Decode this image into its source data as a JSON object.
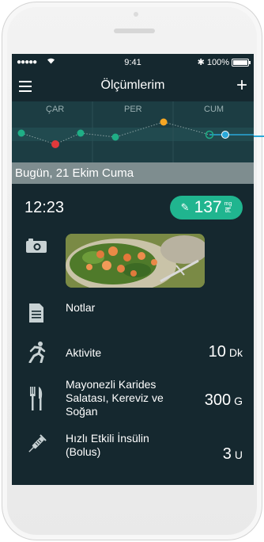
{
  "status_bar": {
    "signal": "●●●●● ",
    "time": "9:41",
    "battery": "✱ 100%"
  },
  "nav": {
    "title": "Ölçümlerim"
  },
  "graph": {
    "days": [
      "ÇAR",
      "PER",
      "CUM"
    ]
  },
  "day_header": "Bugün, 21 Ekim Cuma",
  "entry": {
    "time": "12:23",
    "glucose_value": "137",
    "glucose_unit_top": "mg",
    "glucose_unit_bottom": "dL"
  },
  "items": {
    "notes": "Notlar",
    "activity_label": "Aktivite",
    "activity_value": "10",
    "activity_unit": "Dk",
    "meal_line1": "Mayonezli Karides",
    "meal_line2": "Salatası, Kereviz ve",
    "meal_line3": "Soğan",
    "meal_value": "300",
    "meal_unit": "G",
    "insulin_line1": "Hızlı Etkili İnsülin",
    "insulin_line2": "(Bolus)",
    "insulin_value": "3",
    "insulin_unit": "U"
  },
  "colors": {
    "accent": "#20b58f",
    "background": "#15282f",
    "low": "#e0393b",
    "high": "#f5a623",
    "normal": "#1fae86",
    "selected": "#2aa8d8"
  }
}
